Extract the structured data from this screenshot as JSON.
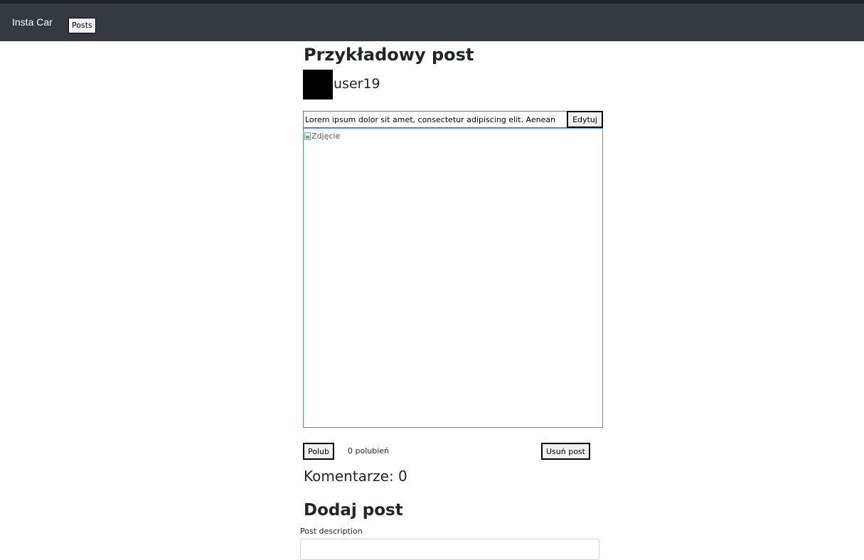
{
  "navbar": {
    "brand": "Insta Car",
    "posts_button": "Posts"
  },
  "post": {
    "title": "Przykładowy post",
    "username": "user19",
    "description_value": "Lorem ipsum dolor sit amet, consectetur adipiscing elit. Aenean",
    "edit_button": "Edytuj",
    "image_alt": "Zdjęcie",
    "like_button": "Polub",
    "likes_text": "0 polubień",
    "delete_button": "Usuń post",
    "comments_text": "Komentarze: 0"
  },
  "add_post": {
    "title": "Dodaj post",
    "description_label": "Post description",
    "description_value": ""
  },
  "colors": {
    "navbar_bg": "#343a40",
    "image_border": "#4a90d9"
  }
}
